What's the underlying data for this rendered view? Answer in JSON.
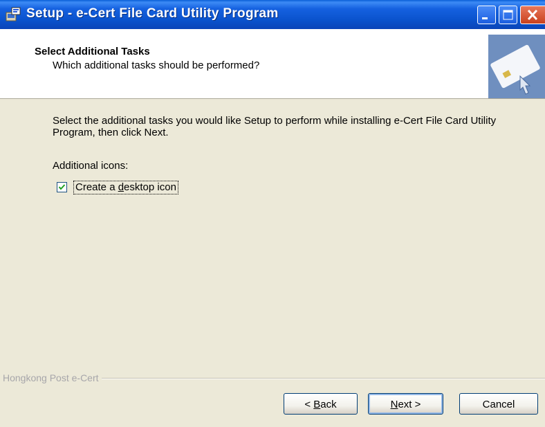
{
  "window": {
    "title": "Setup - e-Cert File Card Utility Program",
    "colors": {
      "titlebar": "#0a52cc",
      "background": "#ece9d8",
      "close": "#c9411d"
    }
  },
  "header": {
    "title": "Select Additional Tasks",
    "subtitle": "Which additional tasks should be performed?",
    "image_icon": "smart-card-icon"
  },
  "body": {
    "description": "Select the additional tasks you would like Setup to perform while installing e-Cert File Card Utility Program, then click Next.",
    "group_label": "Additional icons:",
    "tasks": [
      {
        "label_pre": "Create a ",
        "label_access": "d",
        "label_post": "esktop icon",
        "checked": true
      }
    ]
  },
  "footer": {
    "brand": "Hongkong Post e-Cert",
    "back": {
      "arrow": "< ",
      "access": "B",
      "rest": "ack"
    },
    "next": {
      "access": "N",
      "rest": "ext",
      "arrow": " >"
    },
    "cancel": "Cancel"
  }
}
